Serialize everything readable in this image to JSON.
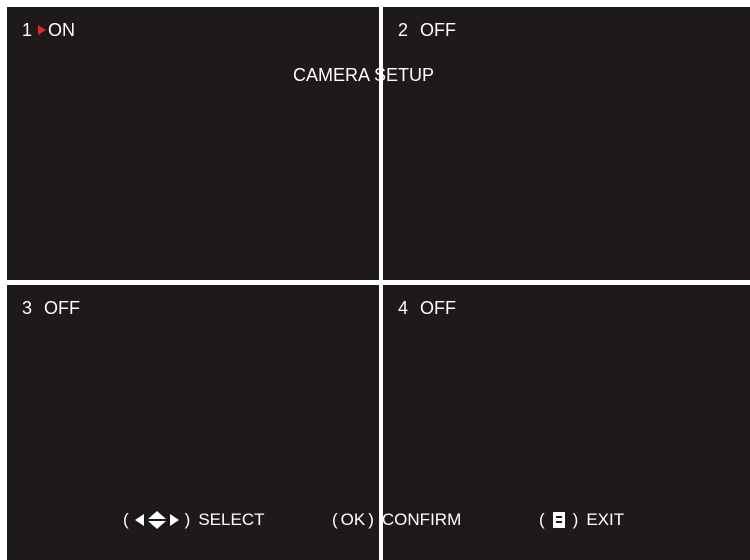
{
  "screen": {
    "title": "CAMERA SETUP",
    "selected_channel": 1,
    "colors": {
      "background": "#1e1a19",
      "divider": "#ffffff",
      "text": "#ffffff",
      "selection_arrow": "#e3262b"
    }
  },
  "channels": [
    {
      "number": "1",
      "status": "ON",
      "selected": true
    },
    {
      "number": "2",
      "status": "OFF",
      "selected": false
    },
    {
      "number": "3",
      "status": "OFF",
      "selected": false
    },
    {
      "number": "4",
      "status": "OFF",
      "selected": false
    }
  ],
  "footer": {
    "select": {
      "open_paren": "(",
      "close_paren": ")",
      "icon": "four-way-arrow-icon",
      "label": "SELECT"
    },
    "confirm": {
      "open_paren": "(",
      "close_paren": ")",
      "key": "OK",
      "label": "CONFIRM"
    },
    "exit": {
      "open_paren": "(",
      "close_paren": ")",
      "icon": "menu-icon",
      "label": "EXIT"
    }
  }
}
